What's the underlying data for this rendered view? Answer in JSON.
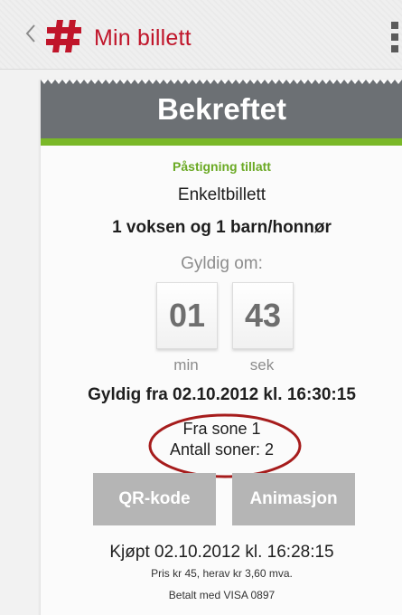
{
  "header": {
    "title": "Min billett",
    "colors": {
      "brand": "#c0152a",
      "bar_background": "#efefef"
    },
    "icons": {
      "back": "chevron-left-icon",
      "logo": "hash-logo-icon",
      "menu": "overflow-menu-icon"
    }
  },
  "ticket": {
    "status": "Bekreftet",
    "boarding": "Påstigning tillatt",
    "type": "Enkeltbillett",
    "passengers": "1 voksen og 1 barn/honnør",
    "valid_in_label": "Gyldig om:",
    "timer": {
      "minutes": "01",
      "seconds": "43",
      "min_label": "min",
      "sec_label": "sek"
    },
    "valid_from": "Gyldig fra 02.10.2012 kl. 16:30:15",
    "zone_from": "Fra sone 1",
    "zone_count": "Antall soner: 2",
    "buttons": {
      "qr": "QR-kode",
      "animation": "Animasjon"
    },
    "purchased": "Kjøpt 02.10.2012 kl. 16:28:15",
    "price": "Pris kr 45, herav kr 3,60 mva.",
    "paid_with": "Betalt med VISA 0897",
    "colors": {
      "header": "#6c7074",
      "accent_green": "#7ab828",
      "button": "#b5b5b5",
      "highlight_ring": "#a61c1c"
    }
  }
}
